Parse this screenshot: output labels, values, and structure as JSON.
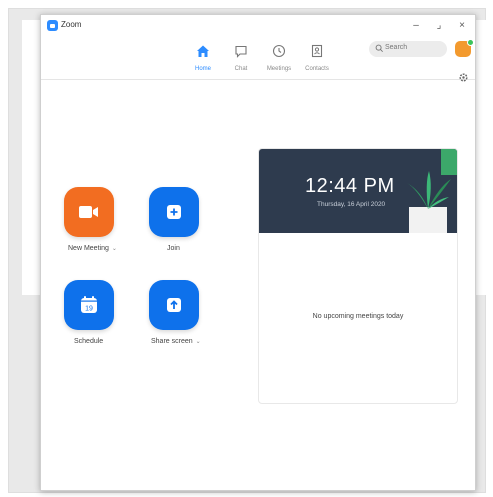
{
  "window": {
    "title": "Zoom",
    "minimize": "–",
    "maximize": "⌟",
    "close": "×"
  },
  "nav": [
    {
      "label": "Home",
      "icon": "home-icon",
      "active": true
    },
    {
      "label": "Chat",
      "icon": "chat-icon",
      "active": false
    },
    {
      "label": "Meetings",
      "icon": "clock-icon",
      "active": false
    },
    {
      "label": "Contacts",
      "icon": "contacts-icon",
      "active": false
    }
  ],
  "search": {
    "placeholder": "Search"
  },
  "actions": [
    {
      "label": "New Meeting",
      "color": "#f26d21",
      "icon": "video-camera-icon",
      "has_dropdown": true
    },
    {
      "label": "Join",
      "color": "#0e71eb",
      "icon": "plus-icon",
      "has_dropdown": false
    },
    {
      "label": "Schedule",
      "color": "#0e71eb",
      "icon": "calendar-icon",
      "day": "19",
      "has_dropdown": false
    },
    {
      "label": "Share screen",
      "color": "#0e71eb",
      "icon": "share-screen-icon",
      "has_dropdown": true
    }
  ],
  "meetings_card": {
    "time": "12:44 PM",
    "date": "Thursday, 16 April 2020",
    "empty_text": "No upcoming meetings today"
  },
  "colors": {
    "accent": "#2d8cff",
    "card_header": "#2e3b4e",
    "avatar": "#f39a2e"
  }
}
